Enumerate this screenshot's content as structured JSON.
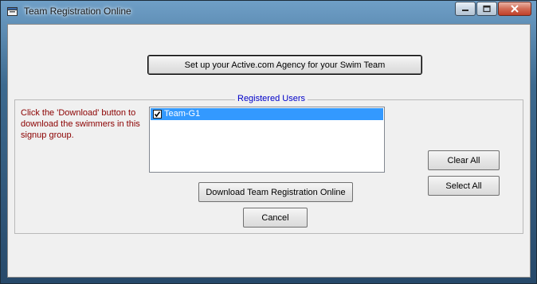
{
  "window": {
    "title": "Team Registration Online"
  },
  "buttons": {
    "setup": "Set up your Active.com Agency for your Swim Team",
    "clear_all": "Clear All",
    "select_all": "Select All",
    "download": "Download Team Registration Online",
    "cancel": "Cancel"
  },
  "registered_users": {
    "label": "Registered Users",
    "hint": "Click the 'Download' button to download the swimmers in this signup group.",
    "items": [
      {
        "label": "Team-G1",
        "checked": true,
        "selected": true
      }
    ]
  },
  "icons": [
    "app-icon",
    "minimize-icon",
    "maximize-icon",
    "close-icon",
    "checkmark-icon"
  ],
  "colors": {
    "hint_text": "#8b0000",
    "group_label": "#0000c8",
    "selection": "#3399ff"
  }
}
